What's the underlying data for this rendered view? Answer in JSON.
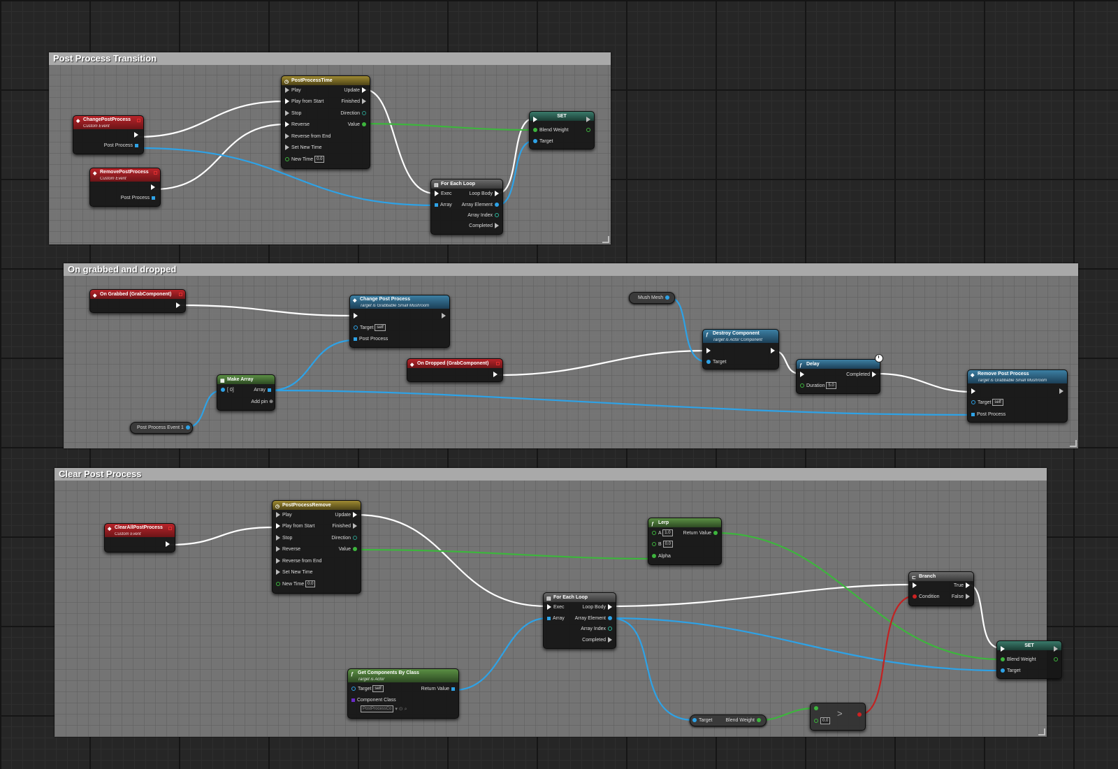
{
  "comments": {
    "transition": "Post Process Transition",
    "grab_drop": "On grabbed and dropped",
    "clear": "Clear Post Process"
  },
  "g1": {
    "change_event": {
      "title": "ChangePostProcess",
      "subtitle": "Custom Event",
      "pin_post_process": "Post Process"
    },
    "remove_event": {
      "title": "RemovePostProcess",
      "subtitle": "Custom Event",
      "pin_post_process": "Post Process"
    },
    "timeline": {
      "title": "PostProcessTime",
      "inputs": [
        "Play",
        "Play from Start",
        "Stop",
        "Reverse",
        "Reverse from End",
        "Set New Time"
      ],
      "new_time_label": "New Time",
      "new_time_value": "0.0",
      "outputs": [
        "Update",
        "Finished",
        "Direction",
        "Value"
      ]
    },
    "foreach": {
      "title": "For Each Loop",
      "exec": "Exec",
      "array": "Array",
      "loop_body": "Loop Body",
      "array_element": "Array Element",
      "array_index": "Array Index",
      "completed": "Completed"
    },
    "set": {
      "title": "SET",
      "blend_weight": "Blend Weight",
      "target": "Target"
    }
  },
  "g2": {
    "on_grabbed": {
      "title": "On Grabbed (GrabComponent)"
    },
    "change_pp": {
      "title": "Change Post Process",
      "subtitle": "Target is Grabbable Small Mushroom",
      "target": "Target",
      "target_value": "self",
      "post_process": "Post Process"
    },
    "make_array": {
      "title": "Make Array",
      "index": "[ 0]",
      "array": "Array",
      "add_pin": "Add pin"
    },
    "pp_event": "Post Process Event 1",
    "on_dropped": {
      "title": "On Dropped (GrabComponent)"
    },
    "mush_mesh": "Mush Mesh",
    "destroy": {
      "title": "Destroy Component",
      "subtitle": "Target is Actor Component",
      "target": "Target"
    },
    "delay": {
      "title": "Delay",
      "completed": "Completed",
      "duration": "Duration",
      "duration_value": "5.0"
    },
    "remove_pp": {
      "title": "Remove Post Process",
      "subtitle": "Target is Grabbable Small Mushroom",
      "target": "Target",
      "target_value": "self",
      "post_process": "Post Process"
    }
  },
  "g3": {
    "clear_event": {
      "title": "ClearAllPostProcess",
      "subtitle": "Custom Event"
    },
    "timeline": {
      "title": "PostProcessRemove",
      "inputs": [
        "Play",
        "Play from Start",
        "Stop",
        "Reverse",
        "Reverse from End",
        "Set New Time"
      ],
      "new_time_label": "New Time",
      "new_time_value": "0.0",
      "outputs": [
        "Update",
        "Finished",
        "Direction",
        "Value"
      ]
    },
    "lerp": {
      "title": "Lerp",
      "a": "A",
      "a_value": "1.0",
      "b": "B",
      "b_value": "0.0",
      "alpha": "Alpha",
      "return_value": "Return Value"
    },
    "foreach": {
      "title": "For Each Loop",
      "exec": "Exec",
      "array": "Array",
      "loop_body": "Loop Body",
      "array_element": "Array Element",
      "array_index": "Array Index",
      "completed": "Completed"
    },
    "get_components": {
      "title": "Get Components By Class",
      "subtitle": "Target is Actor",
      "target": "Target",
      "target_value": "self",
      "return_value": "Return Value",
      "component_class": "Component Class",
      "class_value": "PostProcessCo"
    },
    "getter": {
      "target": "Target",
      "blend_weight": "Blend Weight"
    },
    "compare": {
      "op": ">",
      "b_value": "0.0"
    },
    "branch": {
      "title": "Branch",
      "condition": "Condition",
      "true": "True",
      "false": "False"
    },
    "set": {
      "title": "SET",
      "blend_weight": "Blend Weight",
      "target": "Target"
    }
  },
  "colors": {
    "exec": "#ffffff",
    "float": "#3db53d",
    "object": "#2ea2e6",
    "bool": "#c22222",
    "event": "#b9242a",
    "function": "#3c7fa3",
    "timeline": "#9e8a32",
    "pure": "#5b8f44"
  },
  "icons": [
    "event-diamond-icon",
    "function-icon",
    "clock-icon",
    "loop-icon",
    "array-icon",
    "branch-icon"
  ]
}
